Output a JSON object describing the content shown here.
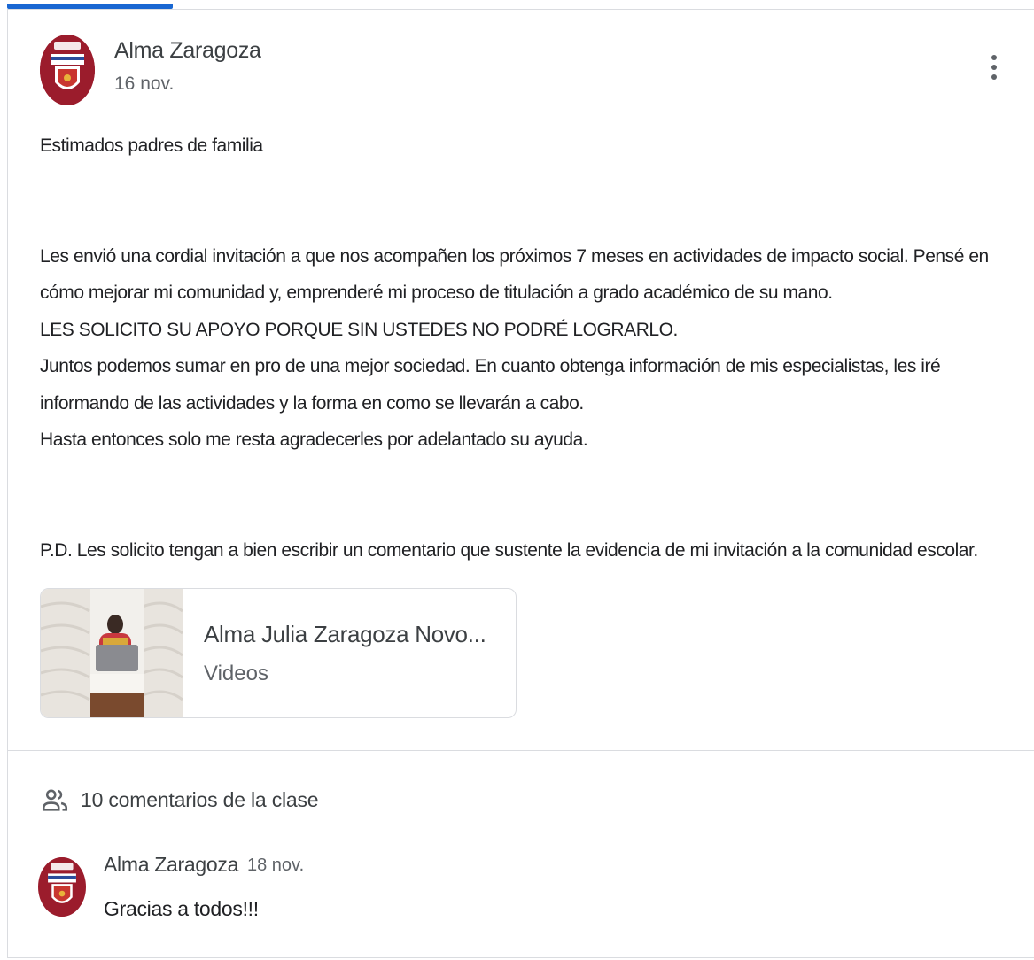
{
  "post": {
    "author": "Alma Zaragoza",
    "date": "16 nov.",
    "greeting": "Estimados padres de familia",
    "paragraphs": [
      "Les envió una cordial invitación a que nos acompañen los próximos 7 meses en actividades de impacto social. Pensé en cómo mejorar mi comunidad y, emprenderé mi proceso de titulación a grado académico de su mano.",
      "LES SOLICITO SU APOYO PORQUE SIN USTEDES NO PODRÉ LOGRARLO.",
      "Juntos podemos sumar en pro de una mejor sociedad. En cuanto obtenga información de mis especialistas, les iré informando de las actividades y la forma en como se llevarán a cabo.",
      "Hasta entonces solo me resta agradecerles por adelantado su ayuda."
    ],
    "postscript": "P.D. Les solicito tengan a bien escribir un comentario que sustente la evidencia de mi invitación a la comunidad escolar.",
    "more_icon": "more-vert-icon"
  },
  "attachment": {
    "title": "Alma Julia Zaragoza Novo...",
    "type": "Videos"
  },
  "comments": {
    "header_label": "10 comentarios de la clase",
    "header_icon": "people-icon",
    "items": [
      {
        "author": "Alma Zaragoza",
        "date": "18 nov.",
        "text": "Gracias a todos!!!"
      }
    ]
  },
  "colors": {
    "accent": "#1967d2",
    "avatar_maroon": "#9b1c2c",
    "text_primary": "#202124",
    "text_secondary": "#5f6368",
    "divider": "#dadce0"
  }
}
